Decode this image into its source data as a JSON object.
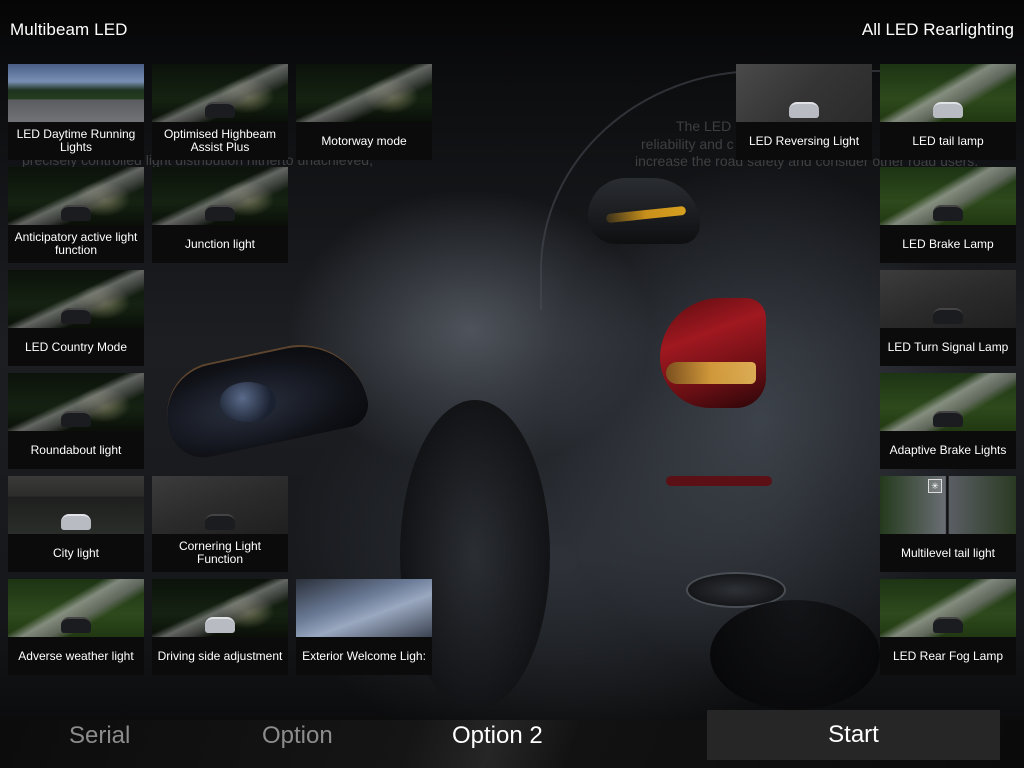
{
  "header": {
    "left_title": "Multibeam LED",
    "right_title": "All LED Rearlighting"
  },
  "background_text": {
    "line1": "The LED",
    "line2": "reliability and c",
    "line3": "increase the road safety and consider other road users.",
    "line4": "precisely controlled light distribution hitherto unachieved,"
  },
  "multibeam_tiles": [
    {
      "label": "LED Daytime Running\nLights",
      "thumb": "day-road"
    },
    {
      "label": "Optimised Highbeam\nAssist Plus",
      "thumb": "night-road"
    },
    {
      "label": "Motorway mode",
      "thumb": "night-road"
    },
    {
      "label": "Anticipatory active light\nfunction",
      "thumb": "night-road"
    },
    {
      "label": "Junction light",
      "thumb": "night-road"
    },
    {
      "label": "LED Country Mode",
      "thumb": "night-road"
    },
    {
      "label": "Roundabout light",
      "thumb": "night-road"
    },
    {
      "label": "City light",
      "thumb": "city"
    },
    {
      "label": "Cornering Light Function",
      "thumb": "grey-road"
    },
    {
      "label": "Adverse weather light",
      "thumb": "green-road"
    },
    {
      "label": "Driving side adjustment",
      "thumb": "night-road"
    },
    {
      "label": "Exterior Welcome Ligh:",
      "thumb": "silver-car"
    }
  ],
  "rear_tiles": [
    {
      "label": "LED Reversing Light",
      "thumb": "parking"
    },
    {
      "label": "LED tail lamp",
      "thumb": "green-road"
    },
    {
      "label": "LED Brake Lamp",
      "thumb": "green-road"
    },
    {
      "label": "LED Turn Signal Lamp",
      "thumb": "grey-road"
    },
    {
      "label": "Adaptive Brake Lights",
      "thumb": "green-road"
    },
    {
      "label": "Multilevel tail light",
      "thumb": "split",
      "badge_icon": "light-icon"
    },
    {
      "label": "LED Rear Fog Lamp",
      "thumb": "green-road"
    }
  ],
  "tabs": [
    {
      "label": "Serial",
      "active": false
    },
    {
      "label": "Option",
      "active": false
    },
    {
      "label": "Option 2",
      "active": true
    }
  ],
  "start_button": {
    "label": "Start"
  },
  "icons": {
    "badge": "✳"
  }
}
